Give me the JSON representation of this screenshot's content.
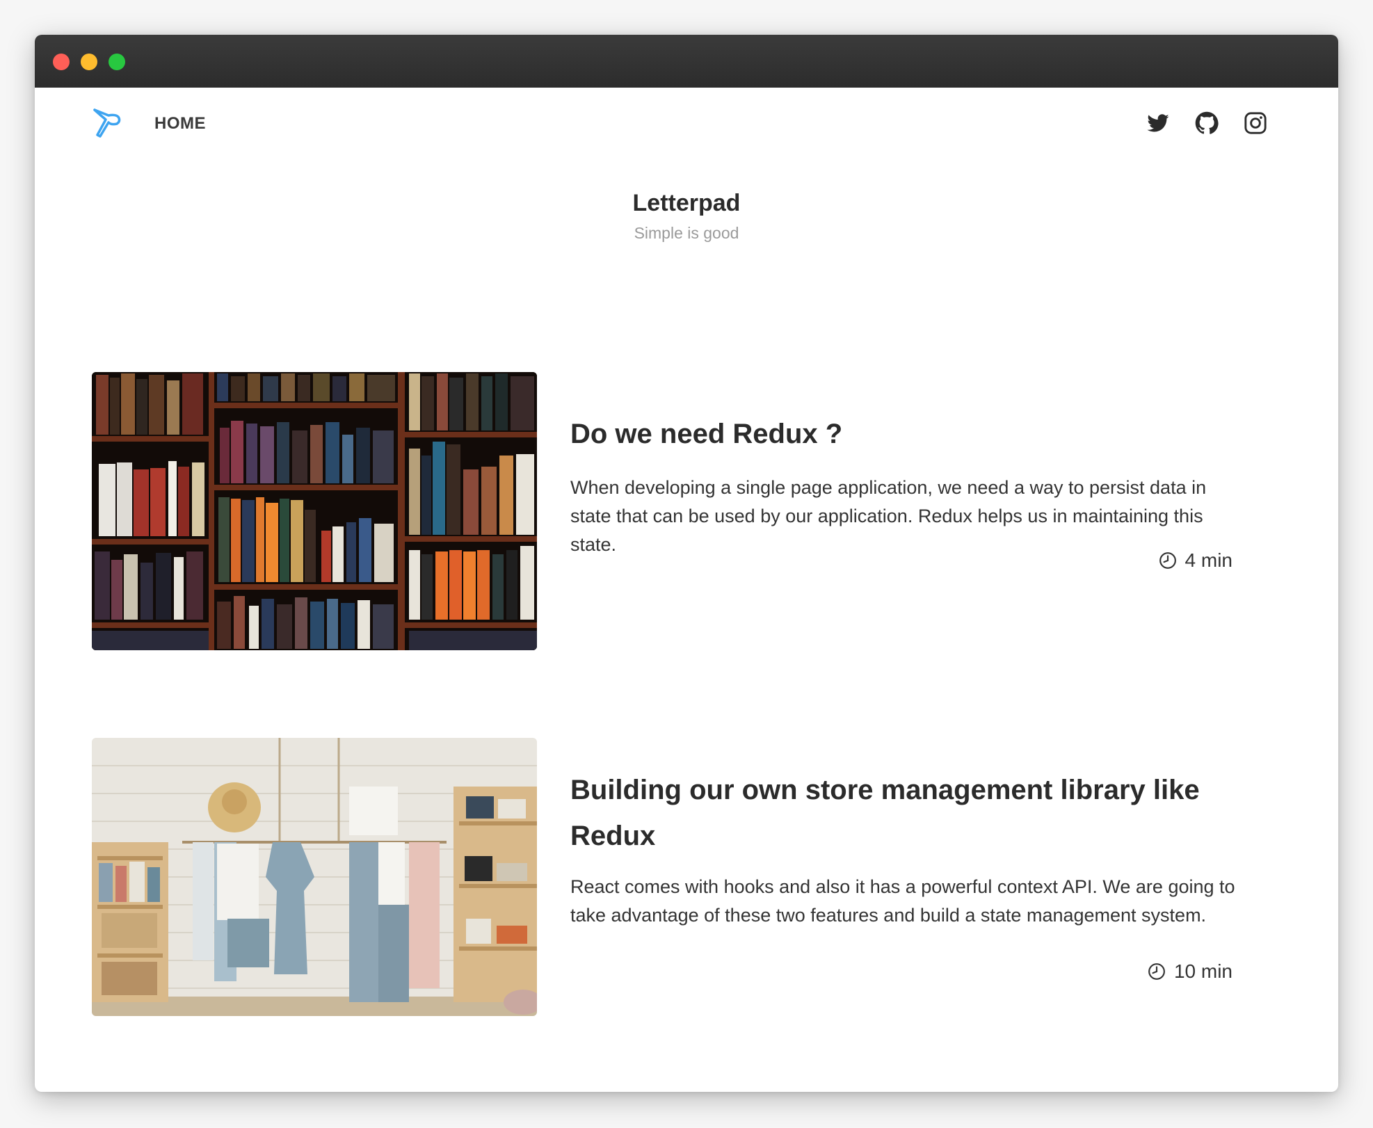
{
  "window": {
    "controls": [
      "close",
      "minimize",
      "maximize"
    ]
  },
  "nav": {
    "logo_icon": "letterpad-logo-icon",
    "home_label": "HOME",
    "social_icons": [
      "twitter-icon",
      "github-icon",
      "instagram-icon"
    ]
  },
  "site": {
    "title": "Letterpad",
    "tagline": "Simple is good"
  },
  "posts": [
    {
      "title": "Do we need Redux ?",
      "excerpt": "When developing a single page application, we need a way to persist data in state that can be used by our application. Redux helps us in maintaining this state.",
      "reading_time": "4 min",
      "image": "bookshelf-photo"
    },
    {
      "title": "Building our own store management library like Redux",
      "excerpt": "React comes with hooks and also it has a powerful context API. We are going to take advantage of these two features and build a state management system.",
      "reading_time": "10 min",
      "image": "clothing-store-photo"
    }
  ],
  "colors": {
    "titlebar": "#2f2f2f",
    "accent_logo": "#3ea4f0",
    "text_dark": "#2b2b2b",
    "tagline": "#9a9a9a"
  }
}
